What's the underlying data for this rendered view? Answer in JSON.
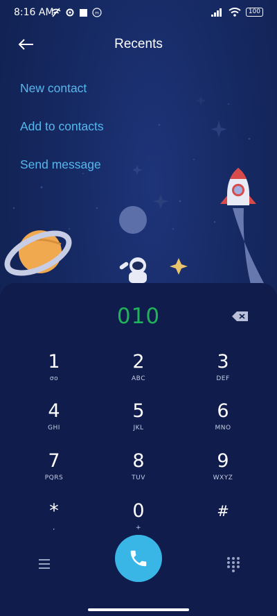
{
  "status_bar": {
    "time": "8:16 AM",
    "battery": "100",
    "icons": [
      "wifi-off-icon",
      "settings-icon",
      "square-icon",
      "shield-icon",
      "signal-icon",
      "wifi-icon",
      "battery-icon"
    ]
  },
  "header": {
    "back_icon": "arrow-left-icon",
    "title": "Recents"
  },
  "actions": [
    {
      "label": "New contact"
    },
    {
      "label": "Add to contacts"
    },
    {
      "label": "Send message"
    }
  ],
  "dialer": {
    "number": "010",
    "keys": [
      {
        "digit": "1",
        "letters": "σο"
      },
      {
        "digit": "2",
        "letters": "ABC"
      },
      {
        "digit": "3",
        "letters": "DEF"
      },
      {
        "digit": "4",
        "letters": "GHI"
      },
      {
        "digit": "5",
        "letters": "JKL"
      },
      {
        "digit": "6",
        "letters": "MNO"
      },
      {
        "digit": "7",
        "letters": "PQRS"
      },
      {
        "digit": "8",
        "letters": "TUV"
      },
      {
        "digit": "9",
        "letters": "WXYZ"
      },
      {
        "digit": "*",
        "letters": ","
      },
      {
        "digit": "0",
        "letters": "+"
      },
      {
        "digit": "#",
        "letters": ""
      }
    ]
  },
  "colors": {
    "background": "#0f1d4a",
    "action_text": "#56b8ee",
    "number_text": "#1fb35a",
    "call_button": "#39b6e6"
  }
}
